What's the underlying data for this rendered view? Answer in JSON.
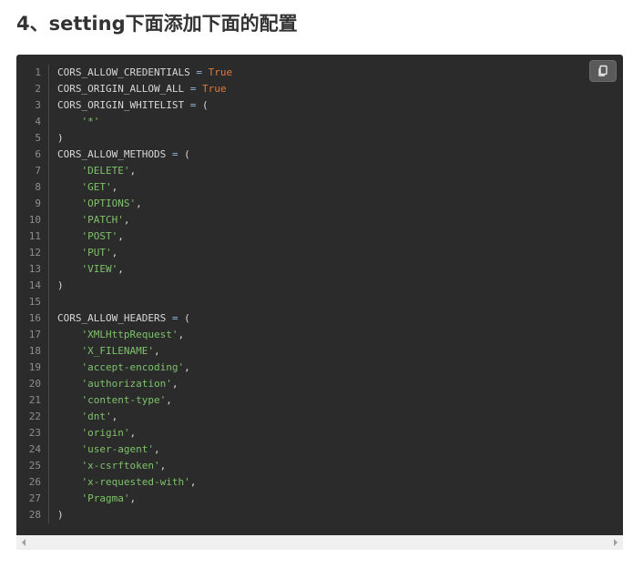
{
  "heading": "4、setting下面添加下面的配置",
  "copy_button": {
    "icon": "copy-icon"
  },
  "colors": {
    "code_bg": "#2b2b2b",
    "keyword": "#e0783a",
    "string": "#7ec26b",
    "text": "#d8d8d8",
    "line_number": "#8e8e8e"
  },
  "code": {
    "line_numbers": [
      "1",
      "2",
      "3",
      "4",
      "5",
      "6",
      "7",
      "8",
      "9",
      "10",
      "11",
      "12",
      "13",
      "14",
      "15",
      "16",
      "17",
      "18",
      "19",
      "20",
      "21",
      "22",
      "23",
      "24",
      "25",
      "26",
      "27",
      "28"
    ],
    "lines": [
      [
        {
          "t": "CORS_ALLOW_CREDENTIALS "
        },
        {
          "t": "=",
          "c": "op"
        },
        {
          "t": " "
        },
        {
          "t": "True",
          "c": "kw"
        }
      ],
      [
        {
          "t": "CORS_ORIGIN_ALLOW_ALL "
        },
        {
          "t": "=",
          "c": "op"
        },
        {
          "t": " "
        },
        {
          "t": "True",
          "c": "kw"
        }
      ],
      [
        {
          "t": "CORS_ORIGIN_WHITELIST "
        },
        {
          "t": "=",
          "c": "op"
        },
        {
          "t": " ("
        }
      ],
      [
        {
          "t": "    "
        },
        {
          "t": "'*'",
          "c": "str"
        }
      ],
      [
        {
          "t": ")"
        }
      ],
      [
        {
          "t": "CORS_ALLOW_METHODS "
        },
        {
          "t": "=",
          "c": "op"
        },
        {
          "t": " ("
        }
      ],
      [
        {
          "t": "    "
        },
        {
          "t": "'DELETE'",
          "c": "str"
        },
        {
          "t": ","
        }
      ],
      [
        {
          "t": "    "
        },
        {
          "t": "'GET'",
          "c": "str"
        },
        {
          "t": ","
        }
      ],
      [
        {
          "t": "    "
        },
        {
          "t": "'OPTIONS'",
          "c": "str"
        },
        {
          "t": ","
        }
      ],
      [
        {
          "t": "    "
        },
        {
          "t": "'PATCH'",
          "c": "str"
        },
        {
          "t": ","
        }
      ],
      [
        {
          "t": "    "
        },
        {
          "t": "'POST'",
          "c": "str"
        },
        {
          "t": ","
        }
      ],
      [
        {
          "t": "    "
        },
        {
          "t": "'PUT'",
          "c": "str"
        },
        {
          "t": ","
        }
      ],
      [
        {
          "t": "    "
        },
        {
          "t": "'VIEW'",
          "c": "str"
        },
        {
          "t": ","
        }
      ],
      [
        {
          "t": ")"
        }
      ],
      [],
      [
        {
          "t": "CORS_ALLOW_HEADERS "
        },
        {
          "t": "=",
          "c": "op"
        },
        {
          "t": " ("
        }
      ],
      [
        {
          "t": "    "
        },
        {
          "t": "'XMLHttpRequest'",
          "c": "str"
        },
        {
          "t": ","
        }
      ],
      [
        {
          "t": "    "
        },
        {
          "t": "'X_FILENAME'",
          "c": "str"
        },
        {
          "t": ","
        }
      ],
      [
        {
          "t": "    "
        },
        {
          "t": "'accept-encoding'",
          "c": "str"
        },
        {
          "t": ","
        }
      ],
      [
        {
          "t": "    "
        },
        {
          "t": "'authorization'",
          "c": "str"
        },
        {
          "t": ","
        }
      ],
      [
        {
          "t": "    "
        },
        {
          "t": "'content-type'",
          "c": "str"
        },
        {
          "t": ","
        }
      ],
      [
        {
          "t": "    "
        },
        {
          "t": "'dnt'",
          "c": "str"
        },
        {
          "t": ","
        }
      ],
      [
        {
          "t": "    "
        },
        {
          "t": "'origin'",
          "c": "str"
        },
        {
          "t": ","
        }
      ],
      [
        {
          "t": "    "
        },
        {
          "t": "'user-agent'",
          "c": "str"
        },
        {
          "t": ","
        }
      ],
      [
        {
          "t": "    "
        },
        {
          "t": "'x-csrftoken'",
          "c": "str"
        },
        {
          "t": ","
        }
      ],
      [
        {
          "t": "    "
        },
        {
          "t": "'x-requested-with'",
          "c": "str"
        },
        {
          "t": ","
        }
      ],
      [
        {
          "t": "    "
        },
        {
          "t": "'Pragma'",
          "c": "str"
        },
        {
          "t": ","
        }
      ],
      [
        {
          "t": ")"
        }
      ]
    ]
  },
  "scrollbar": {
    "left_icon": "arrow-left-icon",
    "right_icon": "arrow-right-icon"
  }
}
